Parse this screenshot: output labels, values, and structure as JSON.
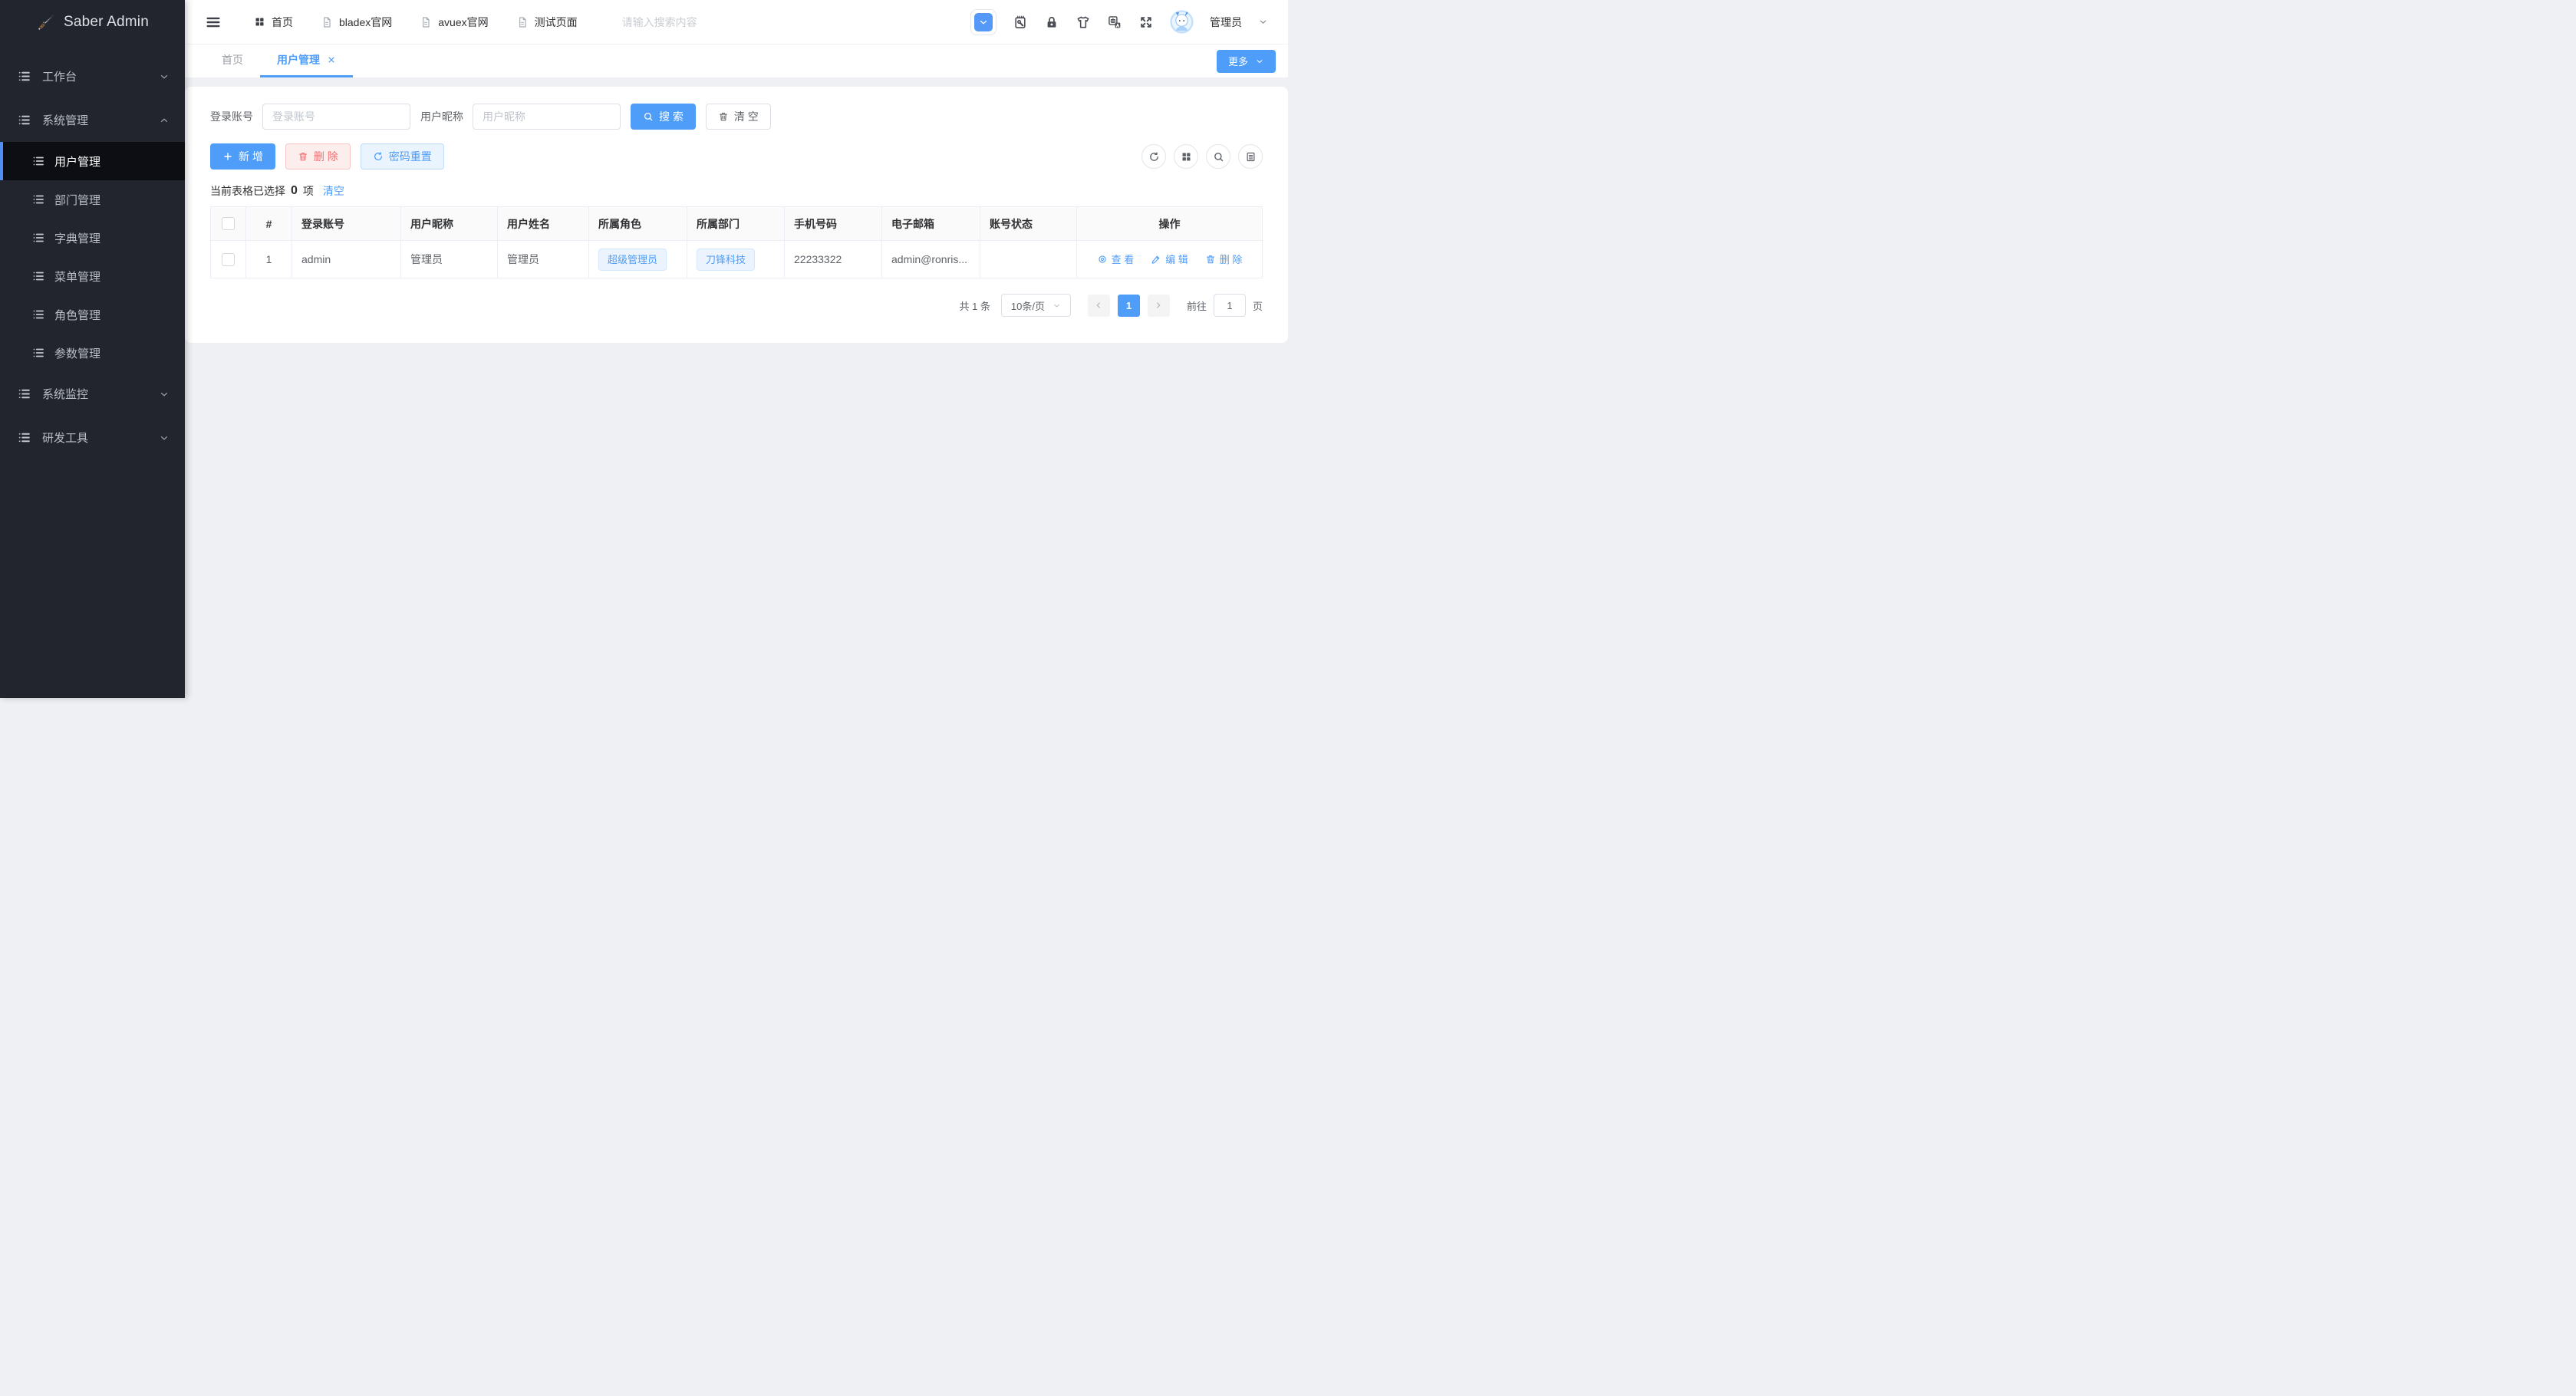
{
  "app": {
    "title": "Saber Admin",
    "logo_icon": "dagger-icon"
  },
  "colors": {
    "accent": "#4e9df9",
    "danger": "#f56c6c",
    "sidebar_bg": "#22252d",
    "sidebar_active_bg": "#0c0e13",
    "content_bg": "#eef0f4"
  },
  "sidebar": {
    "items": [
      {
        "label": "工作台",
        "state": "collapsed"
      },
      {
        "label": "系统管理",
        "state": "expanded",
        "children": [
          {
            "label": "用户管理",
            "active": true
          },
          {
            "label": "部门管理"
          },
          {
            "label": "字典管理"
          },
          {
            "label": "菜单管理"
          },
          {
            "label": "角色管理"
          },
          {
            "label": "参数管理"
          }
        ]
      },
      {
        "label": "系统监控",
        "state": "collapsed"
      },
      {
        "label": "研发工具",
        "state": "collapsed"
      }
    ]
  },
  "navbar": {
    "menu": [
      {
        "label": "首页",
        "icon": "grid-icon"
      },
      {
        "label": "bladex官网",
        "icon": "document-icon"
      },
      {
        "label": "avuex官网",
        "icon": "document-icon"
      },
      {
        "label": "测试页面",
        "icon": "document-icon"
      }
    ],
    "search_placeholder": "请输入搜索内容",
    "right_icons": [
      "chevron-down-toggle-icon",
      "clipboard-wrench-icon",
      "lock-icon",
      "theme-shirt-icon",
      "translate-icon",
      "fullscreen-icon"
    ],
    "user_name": "管理员"
  },
  "tabbar": {
    "tabs": [
      {
        "label": "首页",
        "active": false
      },
      {
        "label": "用户管理",
        "active": true,
        "closable": true
      }
    ],
    "more_label": "更多"
  },
  "filters": {
    "fields": [
      {
        "label": "登录账号",
        "placeholder": "登录账号"
      },
      {
        "label": "用户昵称",
        "placeholder": "用户昵称"
      }
    ],
    "search_label": "搜 索",
    "clear_label": "清 空"
  },
  "toolbar": {
    "add_label": "新 增",
    "delete_label": "删 除",
    "reset_password_label": "密码重置",
    "icon_buttons": [
      "refresh-icon",
      "grid-icon",
      "search-icon",
      "list-doc-icon"
    ]
  },
  "selection": {
    "prefix": "当前表格已选择",
    "count": "0",
    "suffix": "项",
    "clear_label": "清空"
  },
  "table": {
    "columns": [
      "#",
      "登录账号",
      "用户昵称",
      "用户姓名",
      "所属角色",
      "所属部门",
      "手机号码",
      "电子邮箱",
      "账号状态",
      "操作"
    ],
    "rows": [
      {
        "index": "1",
        "account": "admin",
        "nickname": "管理员",
        "name": "管理员",
        "role": "超级管理员",
        "dept": "刀锋科技",
        "phone": "22233322",
        "email": "admin@ronris...",
        "status": "",
        "view_label": "查 看",
        "edit_label": "编 辑",
        "delete_label": "删 除"
      }
    ]
  },
  "pagination": {
    "total": "共 1 条",
    "page_size": "10条/页",
    "current_page": "1",
    "goto_prefix": "前往",
    "goto_value": "1",
    "goto_suffix": "页"
  }
}
